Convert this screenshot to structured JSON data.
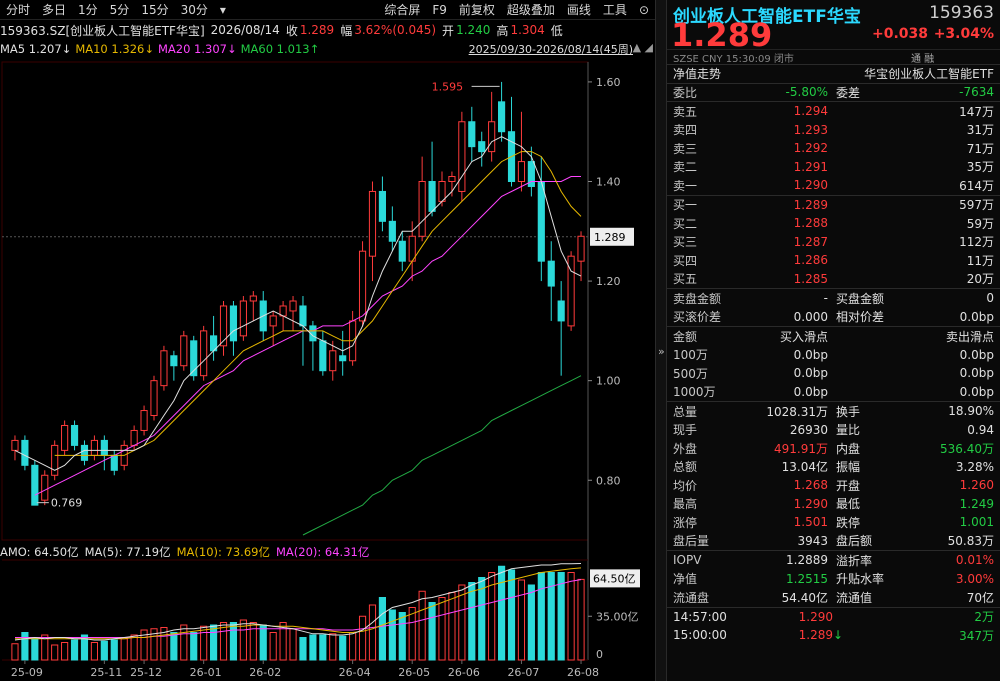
{
  "toolbar": {
    "left": [
      "分时",
      "多日",
      "1分",
      "5分",
      "15分",
      "30分",
      "▾"
    ],
    "right": [
      "综合屏",
      "F9",
      "前复权",
      "超级叠加",
      "画线",
      "工具",
      "⊙"
    ]
  },
  "info": {
    "name": "159363.SZ[创业板人工智能ETF华宝]",
    "date": "2026/08/14",
    "close_label": "收",
    "close": "1.289",
    "amp_label": "幅",
    "amp": "3.62%(0.045)",
    "open_label": "开",
    "open": "1.240",
    "high_label": "高",
    "high": "1.304",
    "low_label": "低"
  },
  "ma": {
    "ma5": "MA5 1.207↓",
    "ma10": "MA10 1.326↓",
    "ma20": "MA20 1.307↓",
    "ma60": "MA60 1.013↑",
    "range": "2025/09/30-2026/08/14(45周)",
    "btns": "▲ ◢"
  },
  "chart_labels": {
    "high": "1.595",
    "low": "0.769",
    "last": "1.289",
    "vol_last": "64.50亿",
    "vol_tick": "35.00亿",
    "vol_zero": "0"
  },
  "amo": {
    "amo": "AMO: 64.50亿",
    "ma5": "MA(5): 77.19亿",
    "ma10": "MA(10): 73.69亿",
    "ma20": "MA(20): 64.31亿"
  },
  "colors": {
    "up": "#ff3b3b",
    "down": "#2bd9d9",
    "ma5": "#e0e0e0",
    "ma10": "#e6b800",
    "ma20": "#ff44ff",
    "ma60": "#22aa44"
  },
  "chart_data": {
    "type": "candlestick",
    "y_ticks": [
      0.8,
      1.0,
      1.2,
      1.4,
      1.6
    ],
    "x_ticks": [
      "25-09",
      "25-11",
      "25-12",
      "26-01",
      "26-02",
      "26-04",
      "26-05",
      "26-06",
      "26-07",
      "26-08"
    ],
    "candles": [
      [
        0.86,
        0.88,
        0.84,
        0.89
      ],
      [
        0.88,
        0.83,
        0.82,
        0.89
      ],
      [
        0.83,
        0.75,
        0.75,
        0.84
      ],
      [
        0.76,
        0.81,
        0.75,
        0.82
      ],
      [
        0.81,
        0.87,
        0.8,
        0.88
      ],
      [
        0.86,
        0.91,
        0.85,
        0.92
      ],
      [
        0.91,
        0.87,
        0.86,
        0.92
      ],
      [
        0.87,
        0.84,
        0.83,
        0.88
      ],
      [
        0.85,
        0.88,
        0.84,
        0.89
      ],
      [
        0.88,
        0.85,
        0.82,
        0.89
      ],
      [
        0.85,
        0.82,
        0.81,
        0.86
      ],
      [
        0.83,
        0.87,
        0.82,
        0.88
      ],
      [
        0.87,
        0.9,
        0.86,
        0.91
      ],
      [
        0.9,
        0.94,
        0.89,
        0.95
      ],
      [
        0.93,
        1.0,
        0.92,
        1.01
      ],
      [
        0.99,
        1.06,
        0.98,
        1.07
      ],
      [
        1.05,
        1.03,
        1.0,
        1.06
      ],
      [
        1.03,
        1.09,
        1.02,
        1.1
      ],
      [
        1.08,
        1.01,
        1.0,
        1.09
      ],
      [
        1.01,
        1.1,
        1.0,
        1.11
      ],
      [
        1.09,
        1.06,
        1.04,
        1.13
      ],
      [
        1.07,
        1.15,
        1.05,
        1.16
      ],
      [
        1.15,
        1.08,
        1.05,
        1.16
      ],
      [
        1.09,
        1.16,
        1.08,
        1.17
      ],
      [
        1.16,
        1.17,
        1.12,
        1.18
      ],
      [
        1.16,
        1.1,
        1.08,
        1.18
      ],
      [
        1.11,
        1.13,
        1.07,
        1.14
      ],
      [
        1.13,
        1.15,
        1.1,
        1.16
      ],
      [
        1.14,
        1.16,
        1.1,
        1.17
      ],
      [
        1.15,
        1.11,
        1.03,
        1.17
      ],
      [
        1.11,
        1.08,
        1.02,
        1.12
      ],
      [
        1.08,
        1.02,
        1.01,
        1.1
      ],
      [
        1.02,
        1.06,
        1.0,
        1.08
      ],
      [
        1.05,
        1.04,
        1.01,
        1.1
      ],
      [
        1.04,
        1.12,
        1.03,
        1.14
      ],
      [
        1.12,
        1.26,
        1.11,
        1.28
      ],
      [
        1.25,
        1.38,
        1.2,
        1.4
      ],
      [
        1.38,
        1.32,
        1.3,
        1.41
      ],
      [
        1.32,
        1.28,
        1.26,
        1.35
      ],
      [
        1.28,
        1.24,
        1.22,
        1.3
      ],
      [
        1.24,
        1.29,
        1.2,
        1.32
      ],
      [
        1.29,
        1.4,
        1.28,
        1.45
      ],
      [
        1.4,
        1.34,
        1.33,
        1.48
      ],
      [
        1.36,
        1.4,
        1.35,
        1.42
      ],
      [
        1.4,
        1.41,
        1.37,
        1.42
      ],
      [
        1.38,
        1.52,
        1.36,
        1.54
      ],
      [
        1.52,
        1.47,
        1.44,
        1.55
      ],
      [
        1.48,
        1.46,
        1.43,
        1.5
      ],
      [
        1.46,
        1.52,
        1.44,
        1.58
      ],
      [
        1.56,
        1.5,
        1.48,
        1.6
      ],
      [
        1.5,
        1.4,
        1.39,
        1.57
      ],
      [
        1.4,
        1.44,
        1.38,
        1.54
      ],
      [
        1.44,
        1.39,
        1.37,
        1.47
      ],
      [
        1.4,
        1.24,
        1.2,
        1.45
      ],
      [
        1.24,
        1.19,
        1.12,
        1.28
      ],
      [
        1.16,
        1.12,
        1.01,
        1.2
      ],
      [
        1.11,
        1.25,
        1.1,
        1.26
      ],
      [
        1.24,
        1.29,
        1.2,
        1.3
      ]
    ],
    "ma5": [
      0.86,
      0.85,
      0.84,
      0.83,
      0.82,
      0.83,
      0.85,
      0.86,
      0.86,
      0.86,
      0.86,
      0.86,
      0.86,
      0.87,
      0.9,
      0.93,
      0.96,
      1.0,
      1.02,
      1.04,
      1.06,
      1.08,
      1.1,
      1.11,
      1.12,
      1.13,
      1.14,
      1.13,
      1.12,
      1.11,
      1.09,
      1.08,
      1.07,
      1.06,
      1.07,
      1.11,
      1.17,
      1.22,
      1.26,
      1.3,
      1.3,
      1.32,
      1.34,
      1.36,
      1.38,
      1.41,
      1.44,
      1.45,
      1.48,
      1.49,
      1.48,
      1.47,
      1.45,
      1.4,
      1.33,
      1.26,
      1.22,
      1.21
    ],
    "ma10": [
      null,
      null,
      null,
      null,
      0.85,
      0.85,
      0.85,
      0.85,
      0.85,
      0.85,
      0.85,
      0.85,
      0.86,
      0.87,
      0.88,
      0.9,
      0.92,
      0.94,
      0.96,
      0.98,
      1.0,
      1.02,
      1.04,
      1.06,
      1.07,
      1.08,
      1.09,
      1.1,
      1.1,
      1.1,
      1.1,
      1.1,
      1.09,
      1.08,
      1.08,
      1.1,
      1.12,
      1.15,
      1.18,
      1.21,
      1.24,
      1.27,
      1.3,
      1.32,
      1.34,
      1.36,
      1.38,
      1.4,
      1.42,
      1.44,
      1.45,
      1.46,
      1.46,
      1.45,
      1.42,
      1.38,
      1.35,
      1.33
    ],
    "ma20": [
      null,
      null,
      0.77,
      0.78,
      0.79,
      0.8,
      0.81,
      0.82,
      0.83,
      0.84,
      0.85,
      0.86,
      0.87,
      0.88,
      0.89,
      0.91,
      0.93,
      0.95,
      0.97,
      0.99,
      1.0,
      1.01,
      1.02,
      1.04,
      1.05,
      1.06,
      1.07,
      1.08,
      1.09,
      1.1,
      1.1,
      1.11,
      1.11,
      1.11,
      1.12,
      1.13,
      1.15,
      1.17,
      1.18,
      1.19,
      1.21,
      1.22,
      1.24,
      1.25,
      1.27,
      1.29,
      1.31,
      1.33,
      1.35,
      1.37,
      1.38,
      1.39,
      1.4,
      1.4,
      1.4,
      1.4,
      1.41,
      1.41
    ],
    "ma60": [
      null,
      null,
      null,
      null,
      null,
      null,
      null,
      null,
      null,
      null,
      null,
      null,
      null,
      null,
      null,
      null,
      null,
      null,
      null,
      null,
      null,
      null,
      null,
      null,
      null,
      null,
      null,
      null,
      null,
      0.69,
      0.7,
      0.71,
      0.72,
      0.73,
      0.74,
      0.75,
      0.77,
      0.78,
      0.8,
      0.81,
      0.82,
      0.84,
      0.85,
      0.86,
      0.87,
      0.88,
      0.89,
      0.9,
      0.92,
      0.93,
      0.94,
      0.95,
      0.96,
      0.97,
      0.98,
      0.99,
      1.0,
      1.01
    ],
    "volume": [
      13,
      22,
      18,
      20,
      12,
      14,
      16,
      20,
      14,
      15,
      16,
      17,
      20,
      24,
      25,
      26,
      22,
      28,
      22,
      27,
      28,
      30,
      30,
      32,
      30,
      28,
      22,
      30,
      25,
      18,
      20,
      20,
      21,
      19,
      22,
      35,
      44,
      50,
      40,
      38,
      42,
      55,
      46,
      50,
      54,
      60,
      62,
      66,
      70,
      75,
      72,
      64,
      60,
      70,
      70,
      70,
      70,
      64.5
    ],
    "vol_ma5": [
      16,
      17,
      18,
      17,
      18,
      18,
      17,
      17,
      16,
      16,
      17,
      18,
      19,
      20,
      21,
      22,
      24,
      25,
      25,
      26,
      27,
      28,
      28,
      29,
      29,
      28,
      27,
      26,
      25,
      23,
      21,
      21,
      20,
      20,
      21,
      24,
      30,
      37,
      42,
      44,
      46,
      49,
      50,
      52,
      54,
      56,
      60,
      63,
      67,
      70,
      73,
      74,
      75,
      76,
      76,
      77,
      77,
      77.19
    ],
    "vol_ma10": [
      17,
      17,
      17,
      17,
      17,
      17,
      17,
      17,
      17,
      17,
      17,
      17,
      18,
      18,
      19,
      20,
      21,
      22,
      23,
      24,
      25,
      26,
      27,
      27,
      28,
      28,
      27,
      27,
      27,
      26,
      25,
      24,
      23,
      22,
      22,
      23,
      25,
      28,
      31,
      34,
      37,
      40,
      43,
      46,
      49,
      52,
      55,
      57,
      60,
      62,
      64,
      66,
      68,
      70,
      71,
      72,
      73,
      73.69
    ],
    "vol_ma20": [
      18,
      18,
      18,
      18,
      18,
      18,
      18,
      18,
      18,
      18,
      18,
      18,
      18,
      18,
      19,
      19,
      20,
      21,
      21,
      22,
      22,
      23,
      24,
      24,
      25,
      25,
      25,
      25,
      25,
      25,
      25,
      25,
      24,
      24,
      24,
      25,
      26,
      27,
      28,
      29,
      30,
      32,
      34,
      36,
      38,
      40,
      42,
      44,
      46,
      48,
      50,
      52,
      54,
      57,
      59,
      61,
      63,
      64.31
    ]
  },
  "panel": {
    "name": "创业板人工智能ETF华宝",
    "code": "159363",
    "price": "1.289",
    "change": "+0.038",
    "pct": "+3.04%",
    "market": "SZSE  CNY  15:30:09  闭市",
    "tags": "通  融",
    "nav_label": "净值走势",
    "nav_name": "华宝创业板人工智能ETF",
    "wb_label": "委比",
    "wb": "-5.80%",
    "wc_label": "委差",
    "wc": "-7634",
    "asks": [
      {
        "label": "卖五",
        "price": "1.294",
        "vol": "147万"
      },
      {
        "label": "卖四",
        "price": "1.293",
        "vol": "31万"
      },
      {
        "label": "卖三",
        "price": "1.292",
        "vol": "71万"
      },
      {
        "label": "卖二",
        "price": "1.291",
        "vol": "35万"
      },
      {
        "label": "卖一",
        "price": "1.290",
        "vol": "614万"
      }
    ],
    "bids": [
      {
        "label": "买一",
        "price": "1.289",
        "vol": "597万"
      },
      {
        "label": "买二",
        "price": "1.288",
        "vol": "59万"
      },
      {
        "label": "买三",
        "price": "1.287",
        "vol": "112万"
      },
      {
        "label": "买四",
        "price": "1.286",
        "vol": "11万"
      },
      {
        "label": "买五",
        "price": "1.285",
        "vol": "20万"
      }
    ],
    "slip": {
      "sell_amt_label": "卖盘金额",
      "sell_amt": "-",
      "buy_amt_label": "买盘金额",
      "buy_amt": "0",
      "buy_pd_label": "买滚价差",
      "buy_pd": "0.000",
      "rel_pd_label": "相对价差",
      "rel_pd": "0.0bp",
      "amt_h": "金额",
      "buy_h": "买入滑点",
      "sell_h": "卖出滑点",
      "rows": [
        {
          "amt": "100万",
          "buy": "0.0bp",
          "sell": "0.0bp"
        },
        {
          "amt": "500万",
          "buy": "0.0bp",
          "sell": "0.0bp"
        },
        {
          "amt": "1000万",
          "buy": "0.0bp",
          "sell": "0.0bp"
        }
      ]
    },
    "stats": [
      {
        "l1": "总量",
        "v1": "1028.31万",
        "c1": "w",
        "l2": "换手",
        "v2": "18.90%",
        "c2": "w"
      },
      {
        "l1": "现手",
        "v1": "26930",
        "c1": "w",
        "l2": "量比",
        "v2": "0.94",
        "c2": "w"
      },
      {
        "l1": "外盘",
        "v1": "491.91万",
        "c1": "r",
        "l2": "内盘",
        "v2": "536.40万",
        "c2": "g"
      },
      {
        "l1": "总额",
        "v1": "13.04亿",
        "c1": "w",
        "l2": "振幅",
        "v2": "3.28%",
        "c2": "w"
      },
      {
        "l1": "均价",
        "v1": "1.268",
        "c1": "r",
        "l2": "开盘",
        "v2": "1.260",
        "c2": "r"
      },
      {
        "l1": "最高",
        "v1": "1.290",
        "c1": "r",
        "l2": "最低",
        "v2": "1.249",
        "c2": "g"
      },
      {
        "l1": "涨停",
        "v1": "1.501",
        "c1": "r",
        "l2": "跌停",
        "v2": "1.001",
        "c2": "g"
      },
      {
        "l1": "盘后量",
        "v1": "3943",
        "c1": "w",
        "l2": "盘后额",
        "v2": "50.83万",
        "c2": "w"
      }
    ],
    "iopv": [
      {
        "l1": "IOPV",
        "v1": "1.2889",
        "c1": "w",
        "l2": "溢折率",
        "v2": "0.01%",
        "c2": "r"
      },
      {
        "l1": "净值",
        "v1": "1.2515",
        "c1": "g",
        "l2": "升贴水率",
        "v2": "3.00%",
        "c2": "r"
      },
      {
        "l1": "流通盘",
        "v1": "54.40亿",
        "c1": "w",
        "l2": "流通值",
        "v2": "70亿",
        "c2": "w"
      }
    ],
    "ticks": [
      {
        "time": "14:57:00",
        "price": "1.290",
        "vol": "2万",
        "dir": ""
      },
      {
        "time": "15:00:00",
        "price": "1.289",
        "vol": "347万",
        "dir": "↓"
      }
    ]
  }
}
